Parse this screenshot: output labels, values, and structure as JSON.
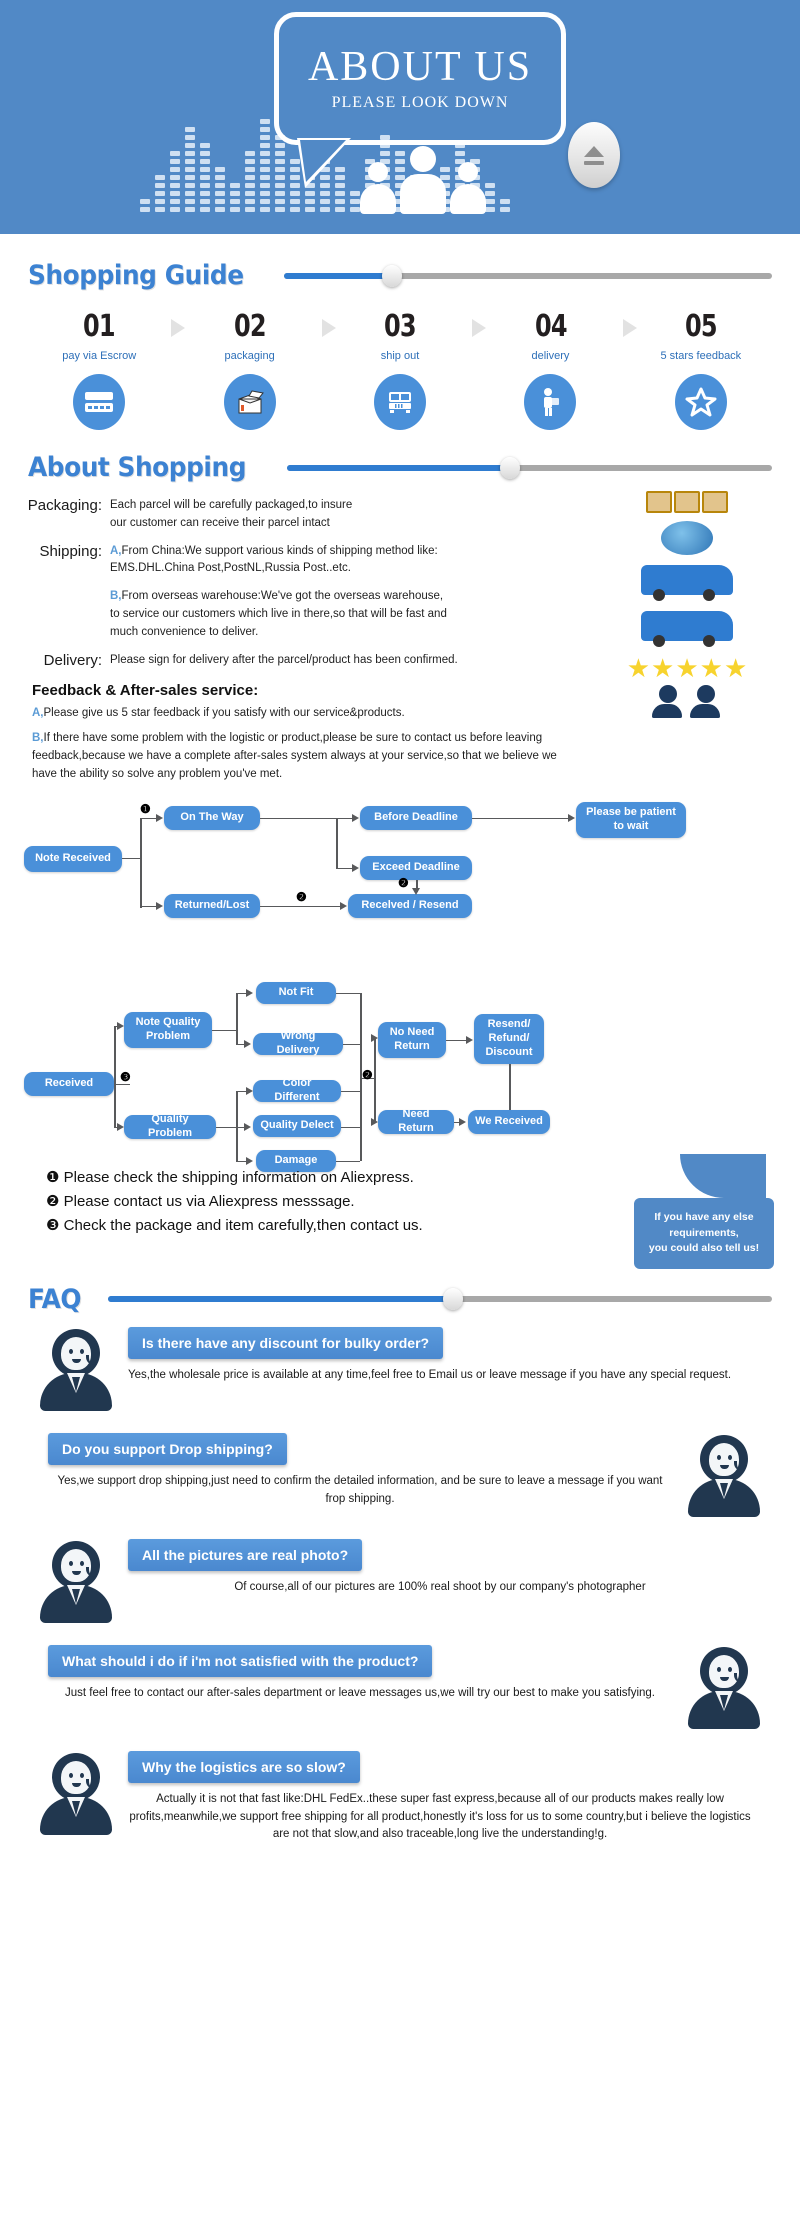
{
  "hero": {
    "title": "ABOUT US",
    "subtitle": "PLEASE LOOK DOWN",
    "eject_icon": "eject-icon",
    "people_icon": "people-group-icon",
    "equalizer_icon": "equalizer-bars-icon"
  },
  "colors": {
    "brand_blue": "#5189c6",
    "accent_blue": "#4a90d9",
    "title_blue": "#3c82d2",
    "slider_track": "#a8a8a8",
    "slider_fill": "#2f7cd0",
    "star_yellow": "#f7d32e",
    "avatar_navy": "#21374f"
  },
  "sections": {
    "shopping_guide": {
      "title": "Shopping Guide",
      "slider_percent": 22
    },
    "about_shopping": {
      "title": "About Shopping",
      "slider_percent": 46
    },
    "faq": {
      "title": "FAQ",
      "slider_percent": 52
    }
  },
  "steps": [
    {
      "num": "01",
      "label": "pay via Escrow",
      "icon": "credit-card-icon"
    },
    {
      "num": "02",
      "label": "packaging",
      "icon": "open-box-icon"
    },
    {
      "num": "03",
      "label": "ship out",
      "icon": "bus-truck-icon"
    },
    {
      "num": "04",
      "label": "delivery",
      "icon": "delivery-person-icon"
    },
    {
      "num": "05",
      "label": "5 stars feedback",
      "icon": "star-icon"
    }
  ],
  "about": {
    "rows": [
      {
        "label": "Packaging:",
        "lines": [
          {
            "tag": "",
            "text": "Each parcel will be carefully packaged,to insure"
          },
          {
            "tag": "",
            "text": "our customer can receive their parcel intact"
          }
        ]
      },
      {
        "label": "Shipping:",
        "lines": [
          {
            "tag": "A,",
            "text": "From China:We support various kinds of shipping method like:"
          },
          {
            "tag": "",
            "text": "EMS.DHL.China Post,PostNL,Russia Post..etc."
          },
          {
            "tag": "",
            "text": ""
          },
          {
            "tag": "B,",
            "text": "From overseas warehouse:We've got the overseas warehouse,"
          },
          {
            "tag": "",
            "text": "to service our customers which live in there,so that will be fast and"
          },
          {
            "tag": "",
            "text": "much convenience to deliver."
          }
        ]
      },
      {
        "label": "Delivery:",
        "lines": [
          {
            "tag": "",
            "text": "Please sign for delivery after the parcel/product has been confirmed."
          }
        ]
      }
    ],
    "feedback_title": "Feedback & After-sales service:",
    "feedback_a_tag": "A,",
    "feedback_a": "Please give us 5 star feedback if you satisfy with our service&products.",
    "feedback_b_tag": "B,",
    "feedback_b": "If there have some problem with the logistic or product,please be sure to contact us before leaving feedback,because we have a complete after-sales system always at your service,so that we believe we have the ability so solve any problem you've met.",
    "art": {
      "pallet": "pallet-boxes-icon",
      "globe": "globe-icon",
      "truck": "delivery-truck-icon",
      "stars": "five-stars-icon",
      "agents": "support-agents-icon",
      "star_count": 5
    }
  },
  "flow1": {
    "nodes": {
      "note_received": "Note Received",
      "on_the_way": "On The Way",
      "returned_lost": "Returned/Lost",
      "before_deadline": "Before Deadline",
      "exceed_deadline": "Exceed Deadline",
      "received_resend": "Recelved / Resend",
      "please_be_patient": "Please be patient to wait"
    },
    "markers": {
      "one": "❶",
      "two_a": "❷",
      "two_b": "❷"
    }
  },
  "flow2": {
    "nodes": {
      "received": "Received",
      "note_quality_problem": "Note Quality Problem",
      "quality_problem": "Quality Problem",
      "not_fit": "Not Fit",
      "wrong_delivery": "Wrong Delivery",
      "color_different": "Color Different",
      "quality_delect": "Quality Delect",
      "damage": "Damage",
      "no_need_return": "No Need Return",
      "need_return": "Need Return",
      "resend_refund_discount": "Resend/ Refund/ Discount",
      "we_received": "We Received"
    },
    "markers": {
      "three": "❸",
      "two": "❷"
    }
  },
  "notes": [
    {
      "marker": "❶",
      "text": "Please check the shipping information on Aliexpress."
    },
    {
      "marker": "❷",
      "text": "Please contact us via Aliexpress messsage."
    },
    {
      "marker": "❸",
      "text": "Check the package and item carefully,then contact us."
    }
  ],
  "callout": {
    "line1": "If you have any else",
    "line2": "requirements,",
    "line3": "you could also tell us!"
  },
  "faq": [
    {
      "question": "Is there have any discount for bulky order?",
      "answer": "Yes,the wholesale price is available at any time,feel free to Email us or leave message if you have any special request.",
      "avatar_side": "left",
      "answer_align": "left"
    },
    {
      "question": "Do you support Drop shipping?",
      "answer": "Yes,we support drop shipping,just need to confirm the detailed information, and be sure to leave a message if you want frop shipping.",
      "avatar_side": "right",
      "answer_align": "center"
    },
    {
      "question": "All the pictures are real photo?",
      "answer": "Of course,all of our pictures are 100% real shoot by our company's photographer",
      "avatar_side": "left",
      "answer_align": "center"
    },
    {
      "question": "What should i do if i'm not satisfied with the product?",
      "answer": "Just feel free to contact our after-sales department or leave messages us,we will try our best to make you satisfying.",
      "avatar_side": "right",
      "answer_align": "center"
    },
    {
      "question": "Why the logistics are so slow?",
      "answer": "Actually it is not that fast like:DHL FedEx..these super fast express,because all of our products makes really low profits,meanwhile,we support free shipping for all product,honestly it's loss for us to some country,but i believe the logistics are not that slow,and also traceable,long live the understanding!g.",
      "avatar_side": "left",
      "answer_align": "center"
    }
  ]
}
